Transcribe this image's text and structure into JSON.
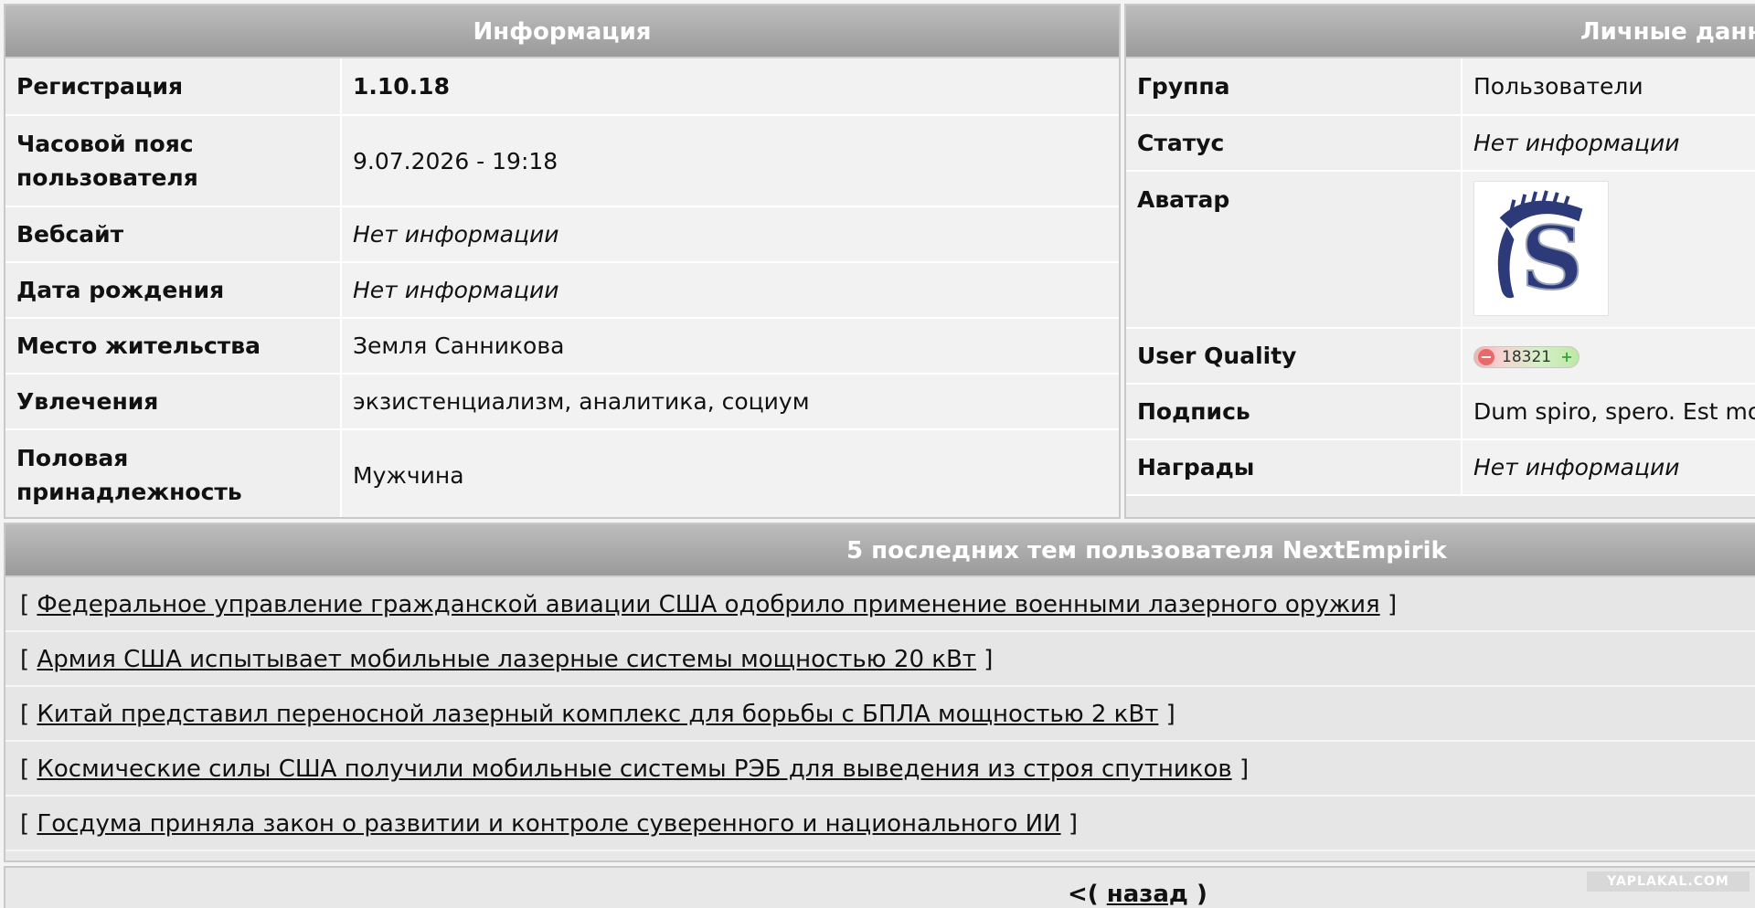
{
  "info_panel": {
    "title": "Информация",
    "rows": [
      {
        "label": "Регистрация",
        "value": "1.10.18"
      },
      {
        "label": "Часовой пояс пользователя",
        "value": "9.07.2026 - 19:18"
      },
      {
        "label": "Вебсайт",
        "value": "Нет информации"
      },
      {
        "label": "Дата рождения",
        "value": "Нет информации"
      },
      {
        "label": "Место жительства",
        "value": "Земля Санникова"
      },
      {
        "label": "Увлечения",
        "value": "экзистенциализм, аналитика, социум"
      },
      {
        "label": "Половая принадлежность",
        "value": "Мужчина"
      }
    ]
  },
  "personal_panel": {
    "title": "Личные данные",
    "group_label": "Группа",
    "group_value": "Пользователи",
    "status_label": "Статус",
    "status_value": "Нет информации",
    "avatar_label": "Аватар",
    "avatar_letter": "S",
    "quality_label": "User Quality",
    "quality_minus": "−",
    "quality_value": "18321",
    "quality_plus": "+",
    "signature_label": "Подпись",
    "signature_value": "Dum spiro, spero. Est modus in rebus.",
    "awards_label": "Награды",
    "awards_value": "Нет информации"
  },
  "topics_panel": {
    "title": "5 последних тем пользователя NextEmpirik",
    "open_bracket": "[",
    "close_bracket": "]",
    "topics": [
      "Федеральное управление гражданской авиации США одобрило применение военными лазерного оружия",
      "Армия США испытывает мобильные лазерные системы мощностью 20 кВт",
      "Китай представил переносной лазерный комплекс для борьбы с БПЛА мощностью 2 кВт",
      "Космические силы США получили мобильные системы РЭБ для выведения из строя спутников",
      "Госдума приняла закон о развитии и контроле суверенного и национального ИИ"
    ]
  },
  "footer": {
    "back_prefix": "<(",
    "back_label": "назад",
    "back_suffix": ")"
  },
  "watermark": "YAPLAKAL.COM"
}
